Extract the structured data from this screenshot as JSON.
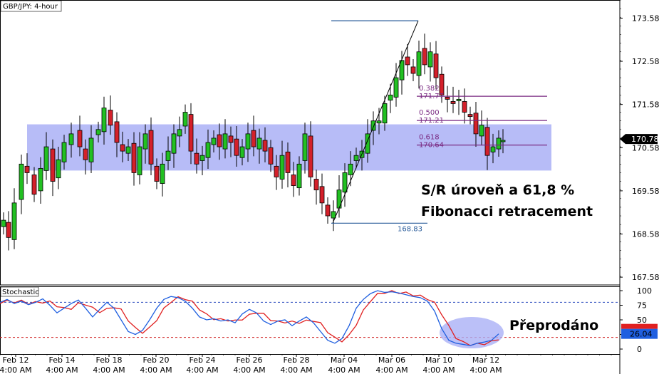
{
  "chart_data": [
    {
      "type": "candlestick",
      "title": "GBP/JPY: 4-hour",
      "y_ticks": [
        "173.58",
        "172.58",
        "171.58",
        "170.58",
        "169.58",
        "168.58",
        "167.58"
      ],
      "ylim": [
        167.4,
        174.0
      ],
      "current_price": "170.78",
      "x_ticks": [
        {
          "date": "Feb 12",
          "time": "4:00 AM"
        },
        {
          "date": "Feb 14",
          "time": "4:00 AM"
        },
        {
          "date": "Feb 18",
          "time": "4:00 AM"
        },
        {
          "date": "Feb 20",
          "time": "4:00 AM"
        },
        {
          "date": "Feb 24",
          "time": "4:00 AM"
        },
        {
          "date": "Feb 26",
          "time": "4:00 AM"
        },
        {
          "date": "Feb 28",
          "time": "4:00 AM"
        },
        {
          "date": "Mar 04",
          "time": "4:00 AM"
        },
        {
          "date": "Mar 06",
          "time": "4:00 AM"
        },
        {
          "date": "Mar 10",
          "time": "4:00 AM"
        },
        {
          "date": "Mar 12",
          "time": "4:00 AM"
        }
      ],
      "sr_zone": [
        170.05,
        171.12
      ],
      "fib": {
        "swing_low": "168.83",
        "swing_high_value": 173.52,
        "levels": [
          {
            "ratio": "0.382",
            "price": "171.77"
          },
          {
            "ratio": "0.500",
            "price": "171.21"
          },
          {
            "ratio": "0.618",
            "price": "170.64"
          }
        ]
      },
      "annotation": {
        "line1": "S/R úroveň a 61,8 %",
        "line2": "Fibonacci retracement"
      },
      "colors": {
        "up": "#22c022",
        "down": "#d4202a",
        "zone": "#aab0f6",
        "fib": "#7a2a82",
        "swing": "#2a5c9a"
      }
    },
    {
      "type": "line",
      "title": "Stochastic",
      "y_ticks": [
        "100",
        "75",
        "50",
        "25",
        "0"
      ],
      "ylim": [
        0,
        100
      ],
      "levels": [
        80,
        20
      ],
      "values": {
        "k": "26.04"
      },
      "annotation": "Přeprodáno",
      "colors": {
        "k": "#1f5fe0",
        "d": "#e02020",
        "oversold_highlight": "#aab0f6"
      }
    }
  ]
}
